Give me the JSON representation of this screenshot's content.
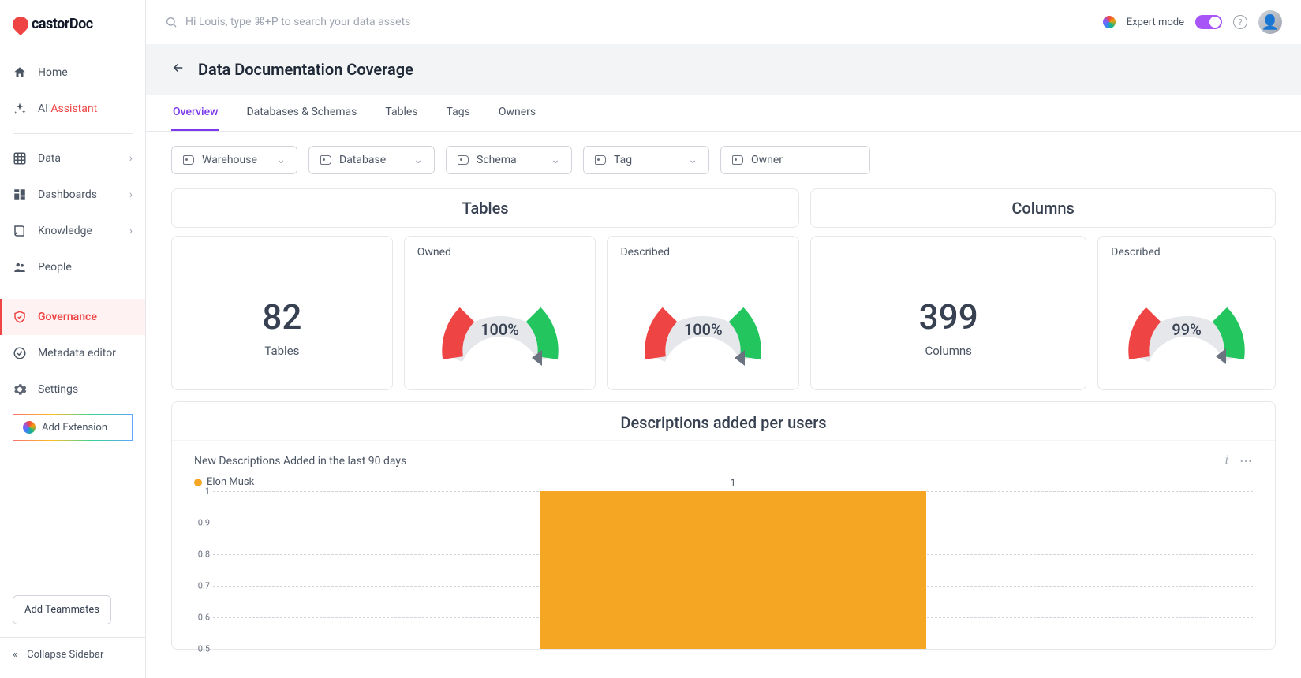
{
  "brand": "castorDoc",
  "search": {
    "placeholder": "Hi Louis, type ⌘+P to search your data assets"
  },
  "topbar": {
    "expert_label": "Expert mode"
  },
  "sidebar": {
    "items": [
      {
        "label": "Home"
      },
      {
        "label_pre": "AI ",
        "label_accent": "Assistant"
      },
      {
        "label": "Data"
      },
      {
        "label": "Dashboards"
      },
      {
        "label": "Knowledge"
      },
      {
        "label": "People"
      },
      {
        "label": "Governance"
      },
      {
        "label": "Metadata editor"
      },
      {
        "label": "Settings"
      }
    ],
    "add_extension": "Add Extension",
    "add_teammates": "Add Teammates",
    "collapse": "Collapse Sidebar"
  },
  "page": {
    "title": "Data Documentation Coverage"
  },
  "tabs": [
    "Overview",
    "Databases & Schemas",
    "Tables",
    "Tags",
    "Owners"
  ],
  "filters": [
    "Warehouse",
    "Database",
    "Schema",
    "Tag",
    "Owner"
  ],
  "stats": {
    "tables": {
      "title": "Tables",
      "count": "82",
      "count_label": "Tables",
      "owned": {
        "label": "Owned",
        "pct": "100%"
      },
      "described": {
        "label": "Described",
        "pct": "100%"
      }
    },
    "columns": {
      "title": "Columns",
      "count": "399",
      "count_label": "Columns",
      "described": {
        "label": "Described",
        "pct": "99%"
      }
    }
  },
  "desc_section": {
    "title": "Descriptions added per users",
    "subtitle": "New Descriptions Added in the last 90 days",
    "legend": {
      "name": "Elon Musk",
      "color": "#f5a623"
    }
  },
  "chart_data": {
    "type": "bar",
    "title": "New Descriptions Added in the last 90 days",
    "series": [
      {
        "name": "Elon Musk",
        "values": [
          1
        ],
        "color": "#f5a623"
      }
    ],
    "categories": [
      ""
    ],
    "ylim": [
      0.5,
      1.0
    ],
    "yticks": [
      0.5,
      0.6,
      0.7,
      0.8,
      0.9,
      1.0
    ],
    "xlabel": "",
    "ylabel": ""
  },
  "colors": {
    "accent": "#7c3aed",
    "danger": "#ef4444",
    "gauge_red": "#ef4444",
    "gauge_green": "#22c55e",
    "gauge_bg": "#e5e7eb"
  }
}
